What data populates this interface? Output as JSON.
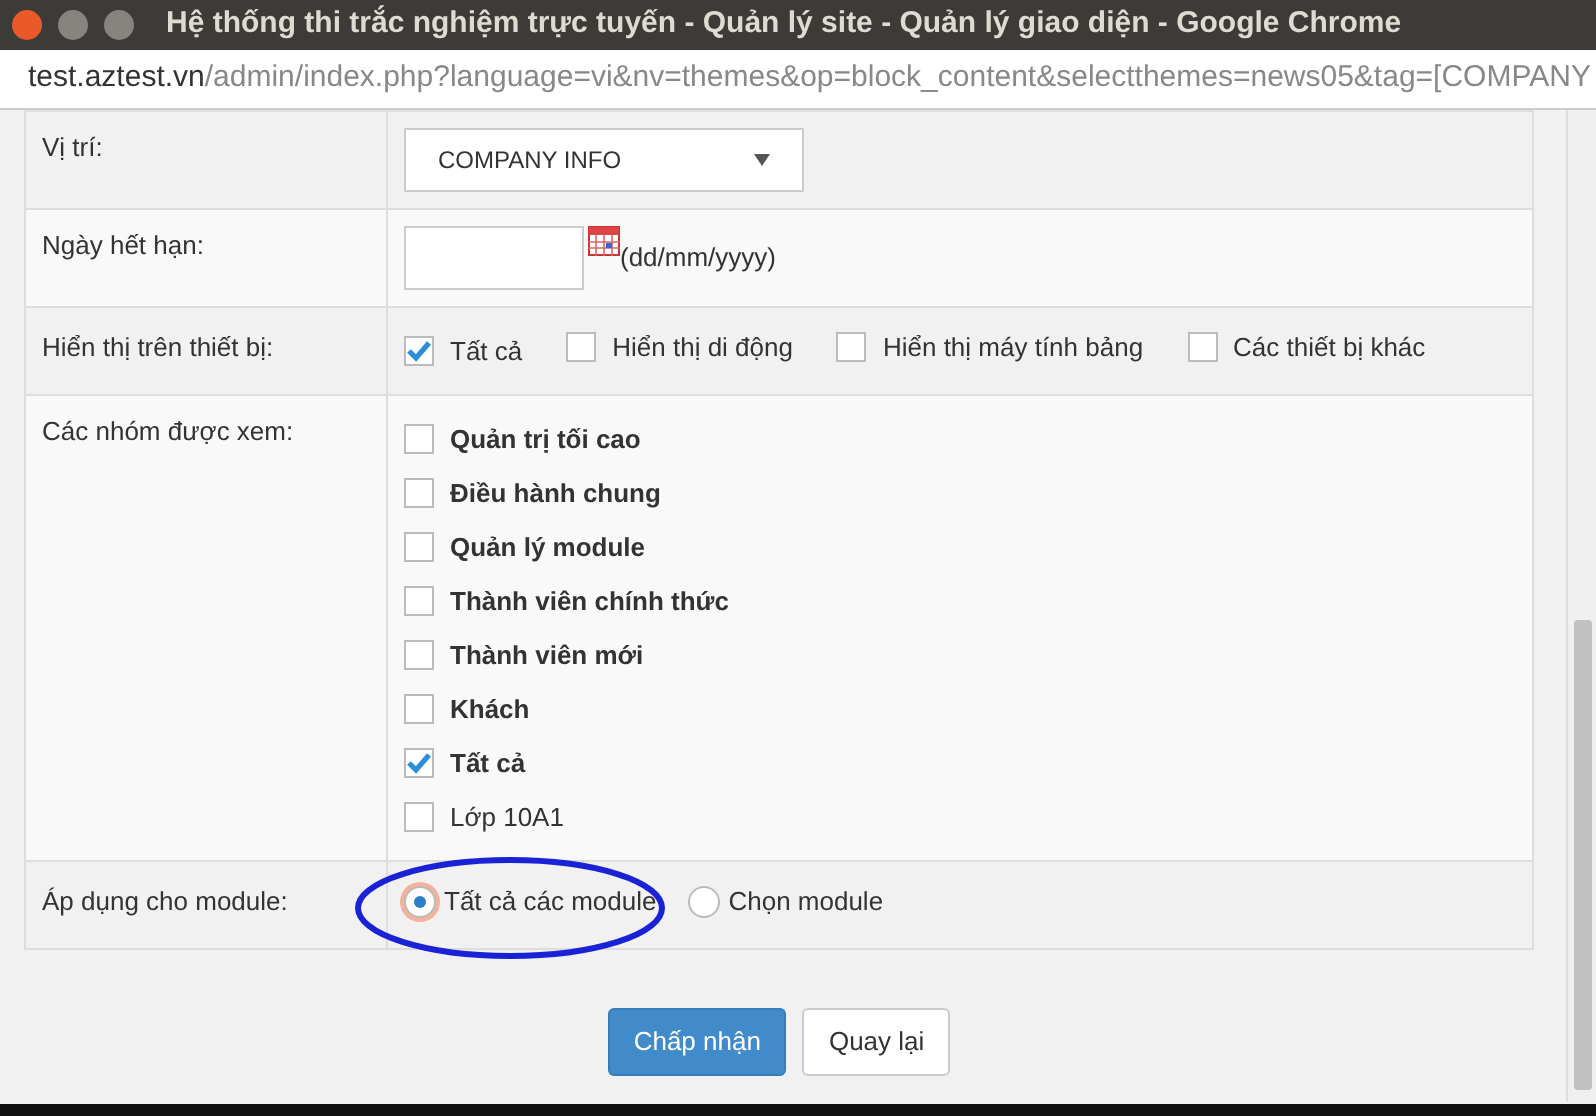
{
  "window": {
    "title": "Hệ thống thi trắc nghiệm trực tuyến - Quản lý site - Quản lý giao diện - Google Chrome"
  },
  "address_bar": {
    "host": "test.aztest.vn",
    "path": "/admin/index.php?language=vi&nv=themes&op=block_content&selectthemes=news05&tag=[COMPANY"
  },
  "form": {
    "rows": [
      {
        "kind": "select",
        "label": "Vị trí:",
        "value": "COMPANY INFO"
      },
      {
        "kind": "date",
        "label": "Ngày hết hạn:",
        "hint": "(dd/mm/yyyy)"
      },
      {
        "kind": "inline_checks",
        "label": "Hiển thị trên thiết bị:",
        "options": [
          {
            "label": "Tất cả",
            "checked": true
          },
          {
            "label": "Hiển thị di động",
            "checked": false
          },
          {
            "label": "Hiển thị máy tính bảng",
            "checked": false
          },
          {
            "label": "Các thiết bị khác",
            "checked": false
          }
        ]
      },
      {
        "kind": "checklist",
        "label": "Các nhóm được xem:",
        "options": [
          {
            "label": "Quản trị tối cao",
            "checked": false,
            "bold": true
          },
          {
            "label": "Điều hành chung",
            "checked": false,
            "bold": true
          },
          {
            "label": "Quản lý module",
            "checked": false,
            "bold": true
          },
          {
            "label": "Thành viên chính thức",
            "checked": false,
            "bold": true
          },
          {
            "label": "Thành viên mới",
            "checked": false,
            "bold": true
          },
          {
            "label": "Khách",
            "checked": false,
            "bold": true
          },
          {
            "label": "Tất cả",
            "checked": true,
            "bold": true
          },
          {
            "label": "Lớp 10A1",
            "checked": false,
            "bold": false
          }
        ]
      },
      {
        "kind": "radios",
        "label": "Áp dụng cho module:",
        "options": [
          {
            "label": "Tất cả các module",
            "selected": true
          },
          {
            "label": "Chọn module",
            "selected": false
          }
        ]
      }
    ]
  },
  "buttons": [
    {
      "label": "Chấp nhận",
      "kind": "primary"
    },
    {
      "label": "Quay lại",
      "kind": "default"
    }
  ]
}
